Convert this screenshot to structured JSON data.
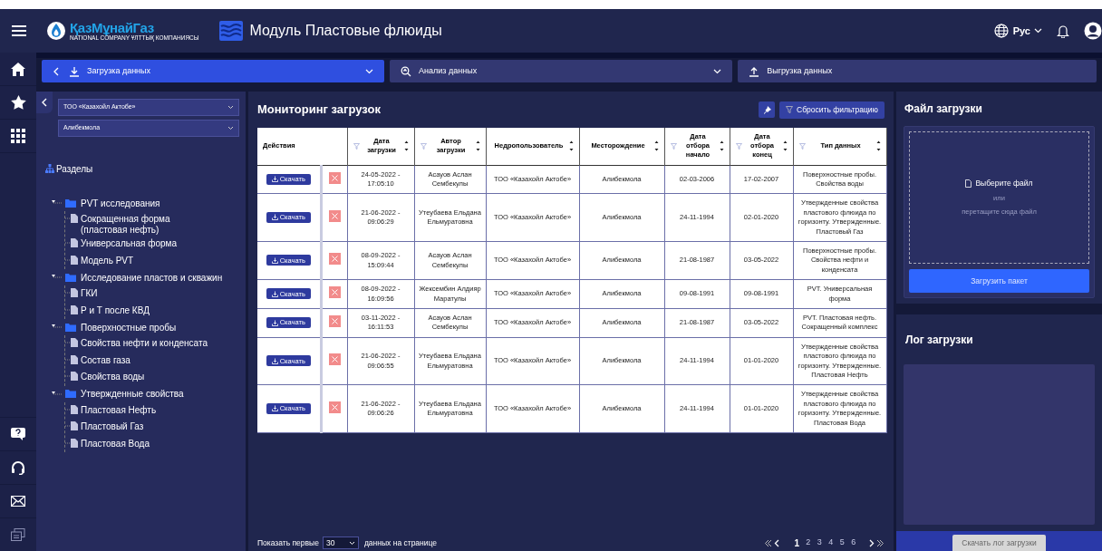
{
  "header": {
    "logo_name": "ҚазМұнайГаз",
    "logo_tagline": "NATIONAL COMPANY ҰЛТТЫҚ КОМПАНИЯСЫ",
    "title": "Модуль Пластовые флюиды",
    "language": "Рус"
  },
  "nav_tabs": [
    {
      "label": "Загрузка данных",
      "selected": true,
      "kind": "download"
    },
    {
      "label": "Анализ данных",
      "selected": false,
      "kind": "analysis"
    },
    {
      "label": "Выгрузка данных",
      "selected": false,
      "kind": "upload"
    }
  ],
  "filters": [
    {
      "value": "ТОО «Казахойл Актобе»"
    },
    {
      "value": "Алибекмола"
    }
  ],
  "sections_title": "Разделы",
  "tree": [
    {
      "label": "PVT исследования",
      "expanded": true,
      "children": [
        {
          "label": "Сокращенная форма (пластовая нефть)"
        },
        {
          "label": "Универсальная форма"
        },
        {
          "label": "Модель PVT"
        }
      ]
    },
    {
      "label": "Исследование пластов и скважин",
      "expanded": true,
      "children": [
        {
          "label": "ГКИ"
        },
        {
          "label": "Р и Т после КВД"
        }
      ]
    },
    {
      "label": "Поверхностные пробы",
      "expanded": true,
      "children": [
        {
          "label": "Свойства нефти и конденсата"
        },
        {
          "label": "Состав газа"
        },
        {
          "label": "Свойства воды"
        }
      ]
    },
    {
      "label": "Утвержденные свойства",
      "expanded": true,
      "children": [
        {
          "label": "Пластовая Нефть"
        },
        {
          "label": "Пластовый Газ"
        },
        {
          "label": "Пластовая Вода"
        }
      ]
    }
  ],
  "monitoring": {
    "title": "Мониторинг загрузок",
    "reset_button": "Сбросить фильтрацию",
    "table": {
      "columns": [
        {
          "label": "Действия",
          "filter": false,
          "sortable": false
        },
        {
          "label": "Дата загрузки",
          "filter": true,
          "sortable": true
        },
        {
          "label": "Автор загрузки",
          "filter": true,
          "sortable": true
        },
        {
          "label": "Недропользователь",
          "filter": false,
          "sortable": true
        },
        {
          "label": "Месторождение",
          "filter": false,
          "sortable": true
        },
        {
          "label": "Дата отбора начало",
          "filter": true,
          "sortable": true
        },
        {
          "label": "Дата отбора конец",
          "filter": true,
          "sortable": true
        },
        {
          "label": "Тип данных",
          "filter": true,
          "sortable": true
        }
      ],
      "rows": [
        {
          "action": "Скачать",
          "date": "24-05-2022 - 17:05:10",
          "author": "Асауов Аслан Сембекулы",
          "company": "ТОО «Казахойл Актобе»",
          "field": "Алибекмола",
          "start": "02-03-2006",
          "end": "17-02-2007",
          "type": "Поверхностные пробы. Свойства воды"
        },
        {
          "action": "Скачать",
          "date": "21-06-2022 - 09:06:29",
          "author": "Утеубаева Ельдана Ельмуратовна",
          "company": "ТОО «Казахойл Актобе»",
          "field": "Алибекмола",
          "start": "24-11-1994",
          "end": "02-01-2020",
          "type": "Утвержденные свойства пластового флюида по горизонту. Утвержденные. Пластовый Газ"
        },
        {
          "action": "Скачать",
          "date": "08-09-2022 - 15:09:44",
          "author": "Асауов Аслан Сембекулы",
          "company": "ТОО «Казахойл Актобе»",
          "field": "Алибекмола",
          "start": "21-08-1987",
          "end": "03-05-2022",
          "type": "Поверхностные пробы. Свойства нефти и конденсата"
        },
        {
          "action": "Скачать",
          "date": "08-09-2022 - 16:09:56",
          "author": "Жексембин Алдияр Маратулы",
          "company": "ТОО «Казахойл Актобе»",
          "field": "Алибекмола",
          "start": "09-08-1991",
          "end": "09-08-1991",
          "type": "PVT. Универсальная форма"
        },
        {
          "action": "Скачать",
          "date": "03-11-2022 - 16:11:53",
          "author": "Асауов Аслан Сембекулы",
          "company": "ТОО «Казахойл Актобе»",
          "field": "Алибекмола",
          "start": "21-08-1987",
          "end": "03-05-2022",
          "type": "PVT. Пластовая нефть. Сокращенный комплекс"
        },
        {
          "action": "Скачать",
          "date": "21-06-2022 - 09:06:55",
          "author": "Утеубаева Ельдана Ельмуратовна",
          "company": "ТОО «Казахойл Актобе»",
          "field": "Алибекмола",
          "start": "24-11-1994",
          "end": "01-01-2020",
          "type": "Утвержденные свойства пластового флюида по горизонту. Утвержденные. Пластовая Нефть"
        },
        {
          "action": "Скачать",
          "date": "21-06-2022 - 09:06:26",
          "author": "Утеубаева Ельдана Ельмуратовна",
          "company": "ТОО «Казахойл Актобе»",
          "field": "Алибекмола",
          "start": "24-11-1994",
          "end": "01-01-2020",
          "type": "Утвержденные свойства пластового флюида по горизонту. Утвержденные. Пластовая Вода"
        }
      ]
    },
    "page_size_label": "Показать первые",
    "page_size": "30",
    "page_size_suffix": "данных на странице",
    "pages": [
      {
        "label": "1",
        "selected": true
      },
      {
        "label": "2",
        "selected": false
      },
      {
        "label": "3",
        "selected": false
      },
      {
        "label": "4",
        "selected": false
      },
      {
        "label": "5",
        "selected": false
      },
      {
        "label": "6",
        "selected": false
      }
    ]
  },
  "upload": {
    "title": "Файл загрузки",
    "choose": "Выберите файл",
    "or": "или",
    "drag": "перетащите сюда файл",
    "button": "Загрузить пакет"
  },
  "log": {
    "title": "Лог загрузки",
    "button": "Скачать лог загрузки"
  }
}
